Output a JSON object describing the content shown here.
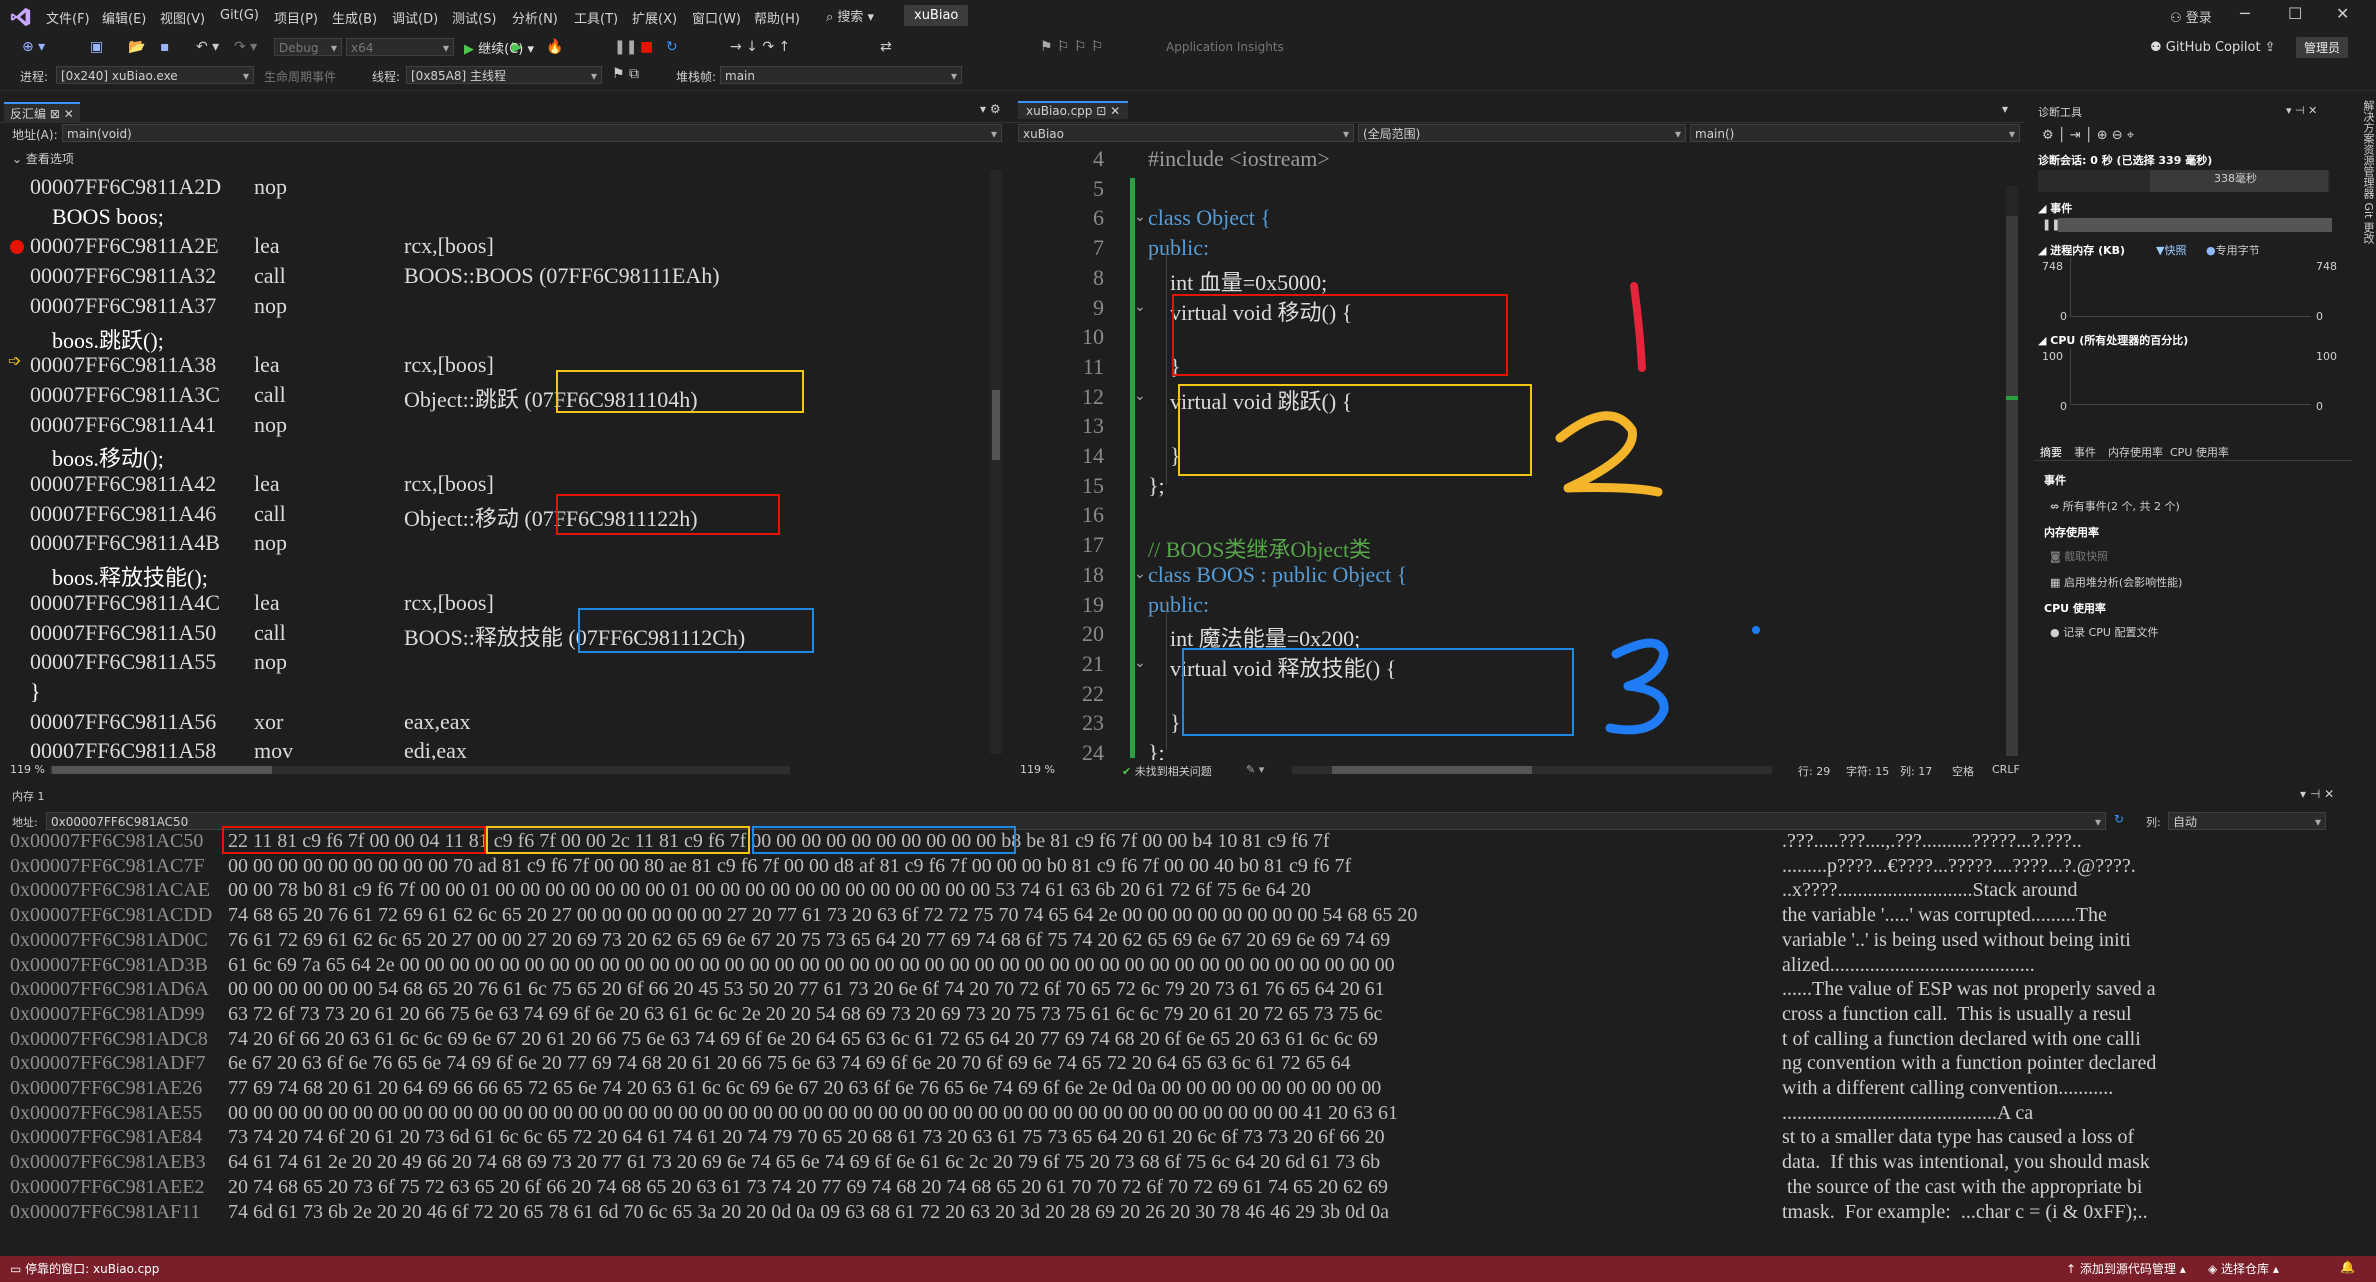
{
  "menu": {
    "items": [
      "文件(F)",
      "编辑(E)",
      "视图(V)",
      "Git(G)",
      "项目(P)",
      "生成(B)",
      "调试(D)",
      "测试(S)",
      "分析(N)",
      "工具(T)",
      "扩展(X)",
      "窗口(W)",
      "帮助(H)"
    ],
    "search": "搜索 ▾",
    "solution": "xuBiao",
    "login": "登录"
  },
  "toolbar": {
    "config": "Debug",
    "platform": "x64",
    "continue": "继续(C)",
    "app_insights": "Application Insights",
    "copilot": "GitHub Copilot",
    "admin": "管理员",
    "process_label": "进程:",
    "process": "[0x240] xuBiao.exe",
    "lifecycle": "生命周期事件",
    "thread_label": "线程:",
    "thread": "[0x85A8] 主线程",
    "stackframe_label": "堆栈帧:",
    "stackframe": "main"
  },
  "disasm": {
    "tab": "反汇编",
    "addr_label": "地址(A):",
    "addr": "main(void)",
    "view_options": "查看选项",
    "zoom": "119 %",
    "lines": [
      {
        "t": "asm",
        "addr": "00007FF6C9811A2D",
        "op": "nop",
        "arg": ""
      },
      {
        "t": "src",
        "text": "    BOOS boos;"
      },
      {
        "t": "asm",
        "addr": "00007FF6C9811A2E",
        "op": "lea",
        "arg": "rcx,[boos]"
      },
      {
        "t": "asm",
        "addr": "00007FF6C9811A32",
        "op": "call",
        "arg": "BOOS::BOOS (07FF6C98111EAh)"
      },
      {
        "t": "asm",
        "addr": "00007FF6C9811A37",
        "op": "nop",
        "arg": ""
      },
      {
        "t": "src",
        "text": "    boos.跳跃();"
      },
      {
        "t": "asm",
        "addr": "00007FF6C9811A38",
        "op": "lea",
        "arg": "rcx,[boos]"
      },
      {
        "t": "asm",
        "addr": "00007FF6C9811A3C",
        "op": "call",
        "arg": "Object::跳跃 (07FF6C9811104h)"
      },
      {
        "t": "asm",
        "addr": "00007FF6C9811A41",
        "op": "nop",
        "arg": ""
      },
      {
        "t": "src",
        "text": "    boos.移动();"
      },
      {
        "t": "asm",
        "addr": "00007FF6C9811A42",
        "op": "lea",
        "arg": "rcx,[boos]"
      },
      {
        "t": "asm",
        "addr": "00007FF6C9811A46",
        "op": "call",
        "arg": "Object::移动 (07FF6C9811122h)"
      },
      {
        "t": "asm",
        "addr": "00007FF6C9811A4B",
        "op": "nop",
        "arg": ""
      },
      {
        "t": "src",
        "text": "    boos.释放技能();"
      },
      {
        "t": "asm",
        "addr": "00007FF6C9811A4C",
        "op": "lea",
        "arg": "rcx,[boos]"
      },
      {
        "t": "asm",
        "addr": "00007FF6C9811A50",
        "op": "call",
        "arg": "BOOS::释放技能 (07FF6C981112Ch)"
      },
      {
        "t": "asm",
        "addr": "00007FF6C9811A55",
        "op": "nop",
        "arg": ""
      },
      {
        "t": "src",
        "text": "}"
      },
      {
        "t": "asm",
        "addr": "00007FF6C9811A56",
        "op": "xor",
        "arg": "eax,eax"
      },
      {
        "t": "asm",
        "addr": "00007FF6C9811A58",
        "op": "mov",
        "arg": "edi,eax"
      }
    ]
  },
  "editor": {
    "tab": "xuBiao.cpp",
    "project": "xuBiao",
    "scope": "(全局范围)",
    "func": "main()",
    "zoom": "119 %",
    "no_issues": "未找到相关问题",
    "line_info": "行: 29",
    "char_info": "字符: 15",
    "col_info": "列: 17",
    "space": "空格",
    "crlf": "CRLF",
    "line_numbers": [
      "4",
      "5",
      "6",
      "7",
      "8",
      "9",
      "10",
      "11",
      "12",
      "13",
      "14",
      "15",
      "16",
      "17",
      "18",
      "19",
      "20",
      "21",
      "22",
      "23",
      "24"
    ],
    "lines": [
      "#include <iostream>",
      "",
      "class Object {",
      "public:",
      "    int 血量=0x5000;",
      "    virtual void 移动() {",
      "",
      "    }",
      "    virtual void 跳跃() {",
      "",
      "    }",
      "};",
      "",
      "// BOOS类继承Object类",
      "class BOOS : public Object {",
      "public:",
      "    int 魔法能量=0x200;",
      "    virtual void 释放技能() {",
      "",
      "    }",
      "};"
    ]
  },
  "annotations": [
    "1",
    "2",
    "3"
  ],
  "diag": {
    "title": "诊断工具",
    "session": "诊断会话: 0 秒 (已选择 339 毫秒)",
    "ms": "338毫秒",
    "events": "事件",
    "proc_mem": "进程内存 (KB)",
    "snapshot": "快照",
    "private_bytes": "专用字节",
    "mem_max": "748",
    "mem_min": "0",
    "cpu": "CPU (所有处理器的百分比)",
    "cpu_max": "100",
    "cpu_min": "0",
    "tabs": [
      "摘要",
      "事件",
      "内存使用率",
      "CPU 使用率"
    ],
    "sec_events": "事件",
    "all_events": "所有事件(2 个, 共 2 个)",
    "sec_mem": "内存使用率",
    "take_snapshot": "截取快照",
    "heap_profile": "启用堆分析(会影响性能)",
    "sec_cpu": "CPU 使用率",
    "record_cpu": "记录 CPU 配置文件"
  },
  "side_tabs": "解决方案资源管理器  Git 更改",
  "memory": {
    "title": "内存 1",
    "addr_label": "地址:",
    "addr": "0x00007FF6C981AC50",
    "col_label": "列:",
    "col": "自动",
    "rows": [
      {
        "a": "0x00007FF6C981AC50",
        "h": "22 11 81 c9 f6 7f 00 00 04 11 81 c9 f6 7f 00 00 2c 11 81 c9 f6 7f 00 00 00 00 00 00 00 00 00 00 b8 be 81 c9 f6 7f 00 00 b4 10 81 c9 f6 7f",
        "s": ".???.....???....,.???..........?????...?.???.."
      },
      {
        "a": "0x00007FF6C981AC7F",
        "h": "00 00 00 00 00 00 00 00 00 70 ad 81 c9 f6 7f 00 00 80 ae 81 c9 f6 7f 00 00 d8 af 81 c9 f6 7f 00 00 00 b0 81 c9 f6 7f 00 00 40 b0 81 c9 f6 7f",
        "s": ".........p????...€????...?????....????...?.@????."
      },
      {
        "a": "0x00007FF6C981ACAE",
        "h": "00 00 78 b0 81 c9 f6 7f 00 00 01 00 00 00 00 00 00 00 01 00 00 00 00 00 00 00 00 00 00 00 00 53 74 61 63 6b 20 61 72 6f 75 6e 64 20",
        "s": "..x????...........................Stack around"
      },
      {
        "a": "0x00007FF6C981ACDD",
        "h": "74 68 65 20 76 61 72 69 61 62 6c 65 20 27 00 00 00 00 00 00 27 20 77 61 73 20 63 6f 72 72 75 70 74 65 64 2e 00 00 00 00 00 00 00 00 54 68 65 20",
        "s": "the variable '.....' was corrupted.........The"
      },
      {
        "a": "0x00007FF6C981AD0C",
        "h": "76 61 72 69 61 62 6c 65 20 27 00 00 27 20 69 73 20 62 65 69 6e 67 20 75 73 65 64 20 77 69 74 68 6f 75 74 20 62 65 69 6e 67 20 69 6e 69 74 69",
        "s": "variable '..' is being used without being initi"
      },
      {
        "a": "0x00007FF6C981AD3B",
        "h": "61 6c 69 7a 65 64 2e 00 00 00 00 00 00 00 00 00 00 00 00 00 00 00 00 00 00 00 00 00 00 00 00 00 00 00 00 00 00 00 00 00 00 00 00 00 00 00 00",
        "s": "alized........................................."
      },
      {
        "a": "0x00007FF6C981AD6A",
        "h": "00 00 00 00 00 00 54 68 65 20 76 61 6c 75 65 20 6f 66 20 45 53 50 20 77 61 73 20 6e 6f 74 20 70 72 6f 70 65 72 6c 79 20 73 61 76 65 64 20 61",
        "s": "......The value of ESP was not properly saved a"
      },
      {
        "a": "0x00007FF6C981AD99",
        "h": "63 72 6f 73 73 20 61 20 66 75 6e 63 74 69 6f 6e 20 63 61 6c 6c 2e 20 20 54 68 69 73 20 69 73 20 75 73 75 61 6c 6c 79 20 61 20 72 65 73 75 6c",
        "s": "cross a function call.  This is usually a resul"
      },
      {
        "a": "0x00007FF6C981ADC8",
        "h": "74 20 6f 66 20 63 61 6c 6c 69 6e 67 20 61 20 66 75 6e 63 74 69 6f 6e 20 64 65 63 6c 61 72 65 64 20 77 69 74 68 20 6f 6e 65 20 63 61 6c 6c 69",
        "s": "t of calling a function declared with one calli"
      },
      {
        "a": "0x00007FF6C981ADF7",
        "h": "6e 67 20 63 6f 6e 76 65 6e 74 69 6f 6e 20 77 69 74 68 20 61 20 66 75 6e 63 74 69 6f 6e 20 70 6f 69 6e 74 65 72 20 64 65 63 6c 61 72 65 64",
        "s": "ng convention with a function pointer declared"
      },
      {
        "a": "0x00007FF6C981AE26",
        "h": "77 69 74 68 20 61 20 64 69 66 66 65 72 65 6e 74 20 63 61 6c 6c 69 6e 67 20 63 6f 6e 76 65 6e 74 69 6f 6e 2e 0d 0a 00 00 00 00 00 00 00 00 00",
        "s": "with a different calling convention..........."
      },
      {
        "a": "0x00007FF6C981AE55",
        "h": "00 00 00 00 00 00 00 00 00 00 00 00 00 00 00 00 00 00 00 00 00 00 00 00 00 00 00 00 00 00 00 00 00 00 00 00 00 00 00 00 00 00 00 41 20 63 61",
        "s": "...........................................A ca"
      },
      {
        "a": "0x00007FF6C981AE84",
        "h": "73 74 20 74 6f 20 61 20 73 6d 61 6c 6c 65 72 20 64 61 74 61 20 74 79 70 65 20 68 61 73 20 63 61 75 73 65 64 20 61 20 6c 6f 73 73 20 6f 66 20",
        "s": "st to a smaller data type has caused a loss of"
      },
      {
        "a": "0x00007FF6C981AEB3",
        "h": "64 61 74 61 2e 20 20 49 66 20 74 68 69 73 20 77 61 73 20 69 6e 74 65 6e 74 69 6f 6e 61 6c 2c 20 79 6f 75 20 73 68 6f 75 6c 64 20 6d 61 73 6b",
        "s": "data.  If this was intentional, you should mask"
      },
      {
        "a": "0x00007FF6C981AEE2",
        "h": "20 74 68 65 20 73 6f 75 72 63 65 20 6f 66 20 74 68 65 20 63 61 73 74 20 77 69 74 68 20 74 68 65 20 61 70 70 72 6f 70 72 69 61 74 65 20 62 69",
        "s": " the source of the cast with the appropriate bi"
      },
      {
        "a": "0x00007FF6C981AF11",
        "h": "74 6d 61 73 6b 2e 20 20 46 6f 72 20 65 78 61 6d 70 6c 65 3a 20 20 0d 0a 09 63 68 61 72 20 63 20 3d 20 28 69 20 26 20 30 78 46 46 29 3b 0d 0a",
        "s": "tmask.  For example:  ...char c = (i & 0xFF);.."
      }
    ]
  },
  "status": {
    "ready": "停靠的窗口: xuBiao.cpp",
    "add_source": "添加到源代码管理",
    "select_repo": "选择仓库"
  }
}
